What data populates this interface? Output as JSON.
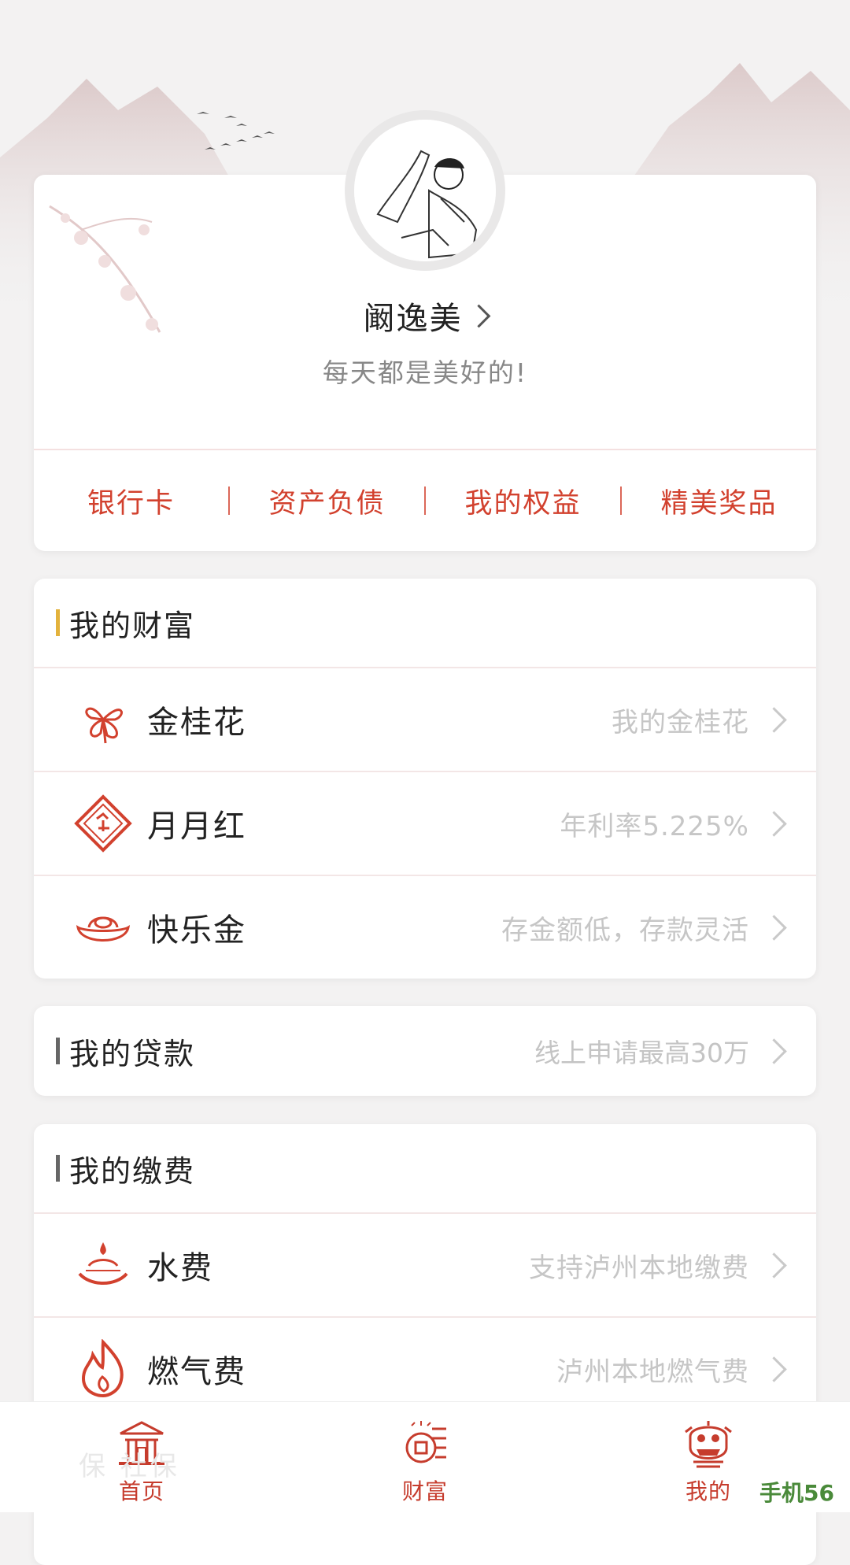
{
  "profile": {
    "name": "阚逸美",
    "motto": "每天都是美好的!",
    "quick_links": [
      "银行卡",
      "资产负债",
      "我的权益",
      "精美奖品"
    ]
  },
  "wealth": {
    "title": "我的财富",
    "accent": "#e3b23c",
    "items": [
      {
        "title": "金桂花",
        "subtitle": "我的金桂花",
        "icon": "osmanthus-icon"
      },
      {
        "title": "月月红",
        "subtitle": "年利率5.225%",
        "icon": "red-diamond-icon"
      },
      {
        "title": "快乐金",
        "subtitle": "存金额低，存款灵活",
        "icon": "gold-ingot-icon"
      }
    ]
  },
  "loan": {
    "title": "我的贷款",
    "subtitle": "线上申请最高30万",
    "accent": "#666666"
  },
  "payment": {
    "title": "我的缴费",
    "accent": "#666666",
    "items": [
      {
        "title": "水费",
        "subtitle": "支持泸州本地缴费",
        "icon": "water-drop-icon"
      },
      {
        "title": "燃气费",
        "subtitle": "泸州本地燃气费",
        "icon": "flame-icon"
      }
    ]
  },
  "tabbar": {
    "items": [
      {
        "label": "首页",
        "icon": "palace-icon"
      },
      {
        "label": "财富",
        "icon": "coin-icon"
      },
      {
        "label": "我的",
        "icon": "lion-dance-icon"
      }
    ]
  },
  "overlay": {
    "ghost_text": "保 社保",
    "watermark": "手机56"
  },
  "colors": {
    "brand_red": "#d2412e",
    "subtle_text": "#c6c6c6"
  }
}
